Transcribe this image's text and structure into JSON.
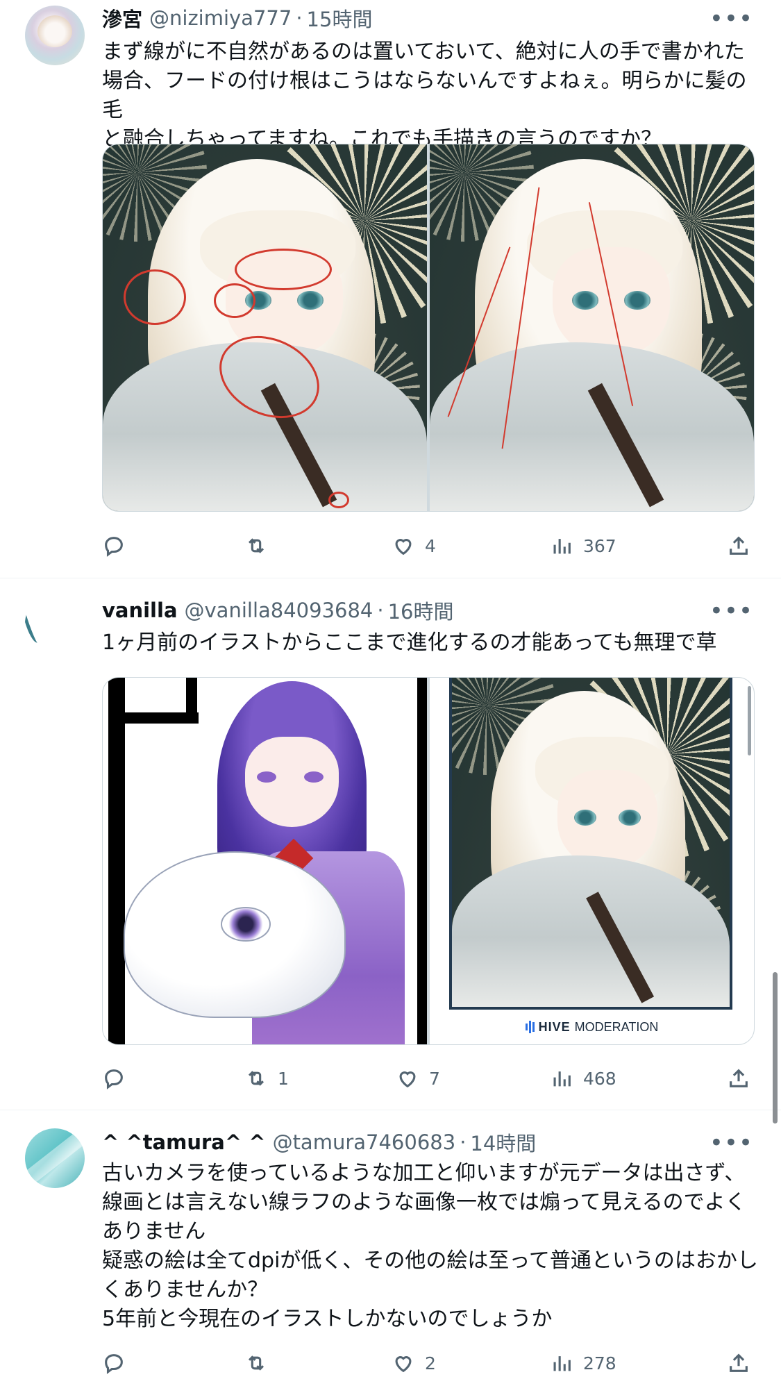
{
  "tweets": [
    {
      "name": "滲宮",
      "handle": "@nizimiya777",
      "time": "15時間",
      "more": "•••",
      "text": "まず線がに不自然があるのは置いておいて、絶対に人の手で書かれた\n場合、フードの付け根はこうはならないんですよねぇ。明らかに髪の毛\nと融合しちゃってますね。これでも手描きの言うのですか？",
      "stats": {
        "reply": "",
        "retweet": "",
        "like": "4",
        "views": "367"
      }
    },
    {
      "name": "vanilla",
      "handle": "@vanilla84093684",
      "time": "16時間",
      "more": "•••",
      "text": "1ヶ月前のイラストからここまで進化するの才能あっても無理で草",
      "media_caption_brand": "HIVE",
      "media_caption_rest": "MODERATION",
      "stats": {
        "reply": "",
        "retweet": "1",
        "like": "7",
        "views": "468"
      }
    },
    {
      "name": "^ ^tamura^ ^",
      "handle": "@tamura7460683",
      "time": "14時間",
      "more": "•••",
      "text": "古いカメラを使っているような加工と仰いますが元データは出さず、\n線画とは言えない線ラフのような画像一枚では煽って見えるのでよく\nありません\n疑惑の絵は全てdpiが低く、その他の絵は至って普通というのはおかし\nくありませんか？\n5年前と今現在のイラストしかないのでしょうか",
      "stats": {
        "reply": "",
        "retweet": "",
        "like": "2",
        "views": "278"
      }
    }
  ],
  "icons": [
    "reply-icon",
    "retweet-icon",
    "like-icon",
    "views-icon",
    "share-icon"
  ],
  "colors": {
    "text": "#0f1419",
    "secondary": "#536471",
    "border": "#cfd9de",
    "annotation_red": "#d23a2e"
  }
}
